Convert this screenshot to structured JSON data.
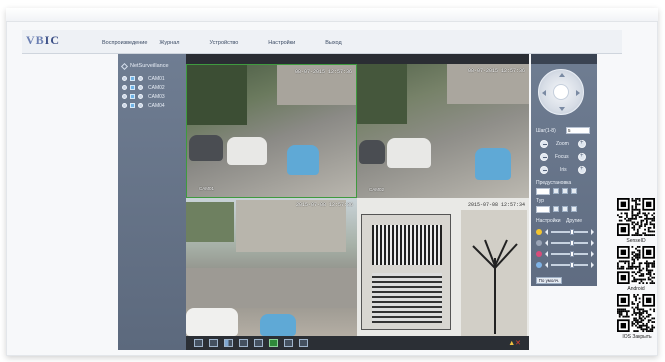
{
  "app": {
    "logo_part1": "VB",
    "logo_part2": "IC"
  },
  "nav": {
    "items": [
      "Воспроизведение",
      "Журнал",
      "Устройство",
      "Настройки",
      "Выход"
    ]
  },
  "left_panel": {
    "title": "NetSurveillance",
    "cameras": [
      "CAM01",
      "CAM02",
      "CAM03",
      "CAM04"
    ]
  },
  "video": {
    "tiles": [
      {
        "timestamp": "08-07-2015 12:57:36",
        "label": "CAM01"
      },
      {
        "timestamp": "08-07-2015 12:57:36",
        "label": "CAM02"
      },
      {
        "timestamp": "2015-07-08 12:57:36",
        "label": ""
      },
      {
        "timestamp": "2015-07-08 12:57:34",
        "label": ""
      }
    ]
  },
  "ptz": {
    "speed_label": "Шаг(1-8)",
    "speed_value": "5",
    "zoom_label": "Zoom",
    "focus_label": "Focus",
    "iris_label": "Iris",
    "preset_label": "Предустановка",
    "tour_label": "Тур",
    "settings_label": "Настройки",
    "other_label": "Другие",
    "default_button": "По умолч."
  },
  "image_sliders": [
    {
      "name": "brightness",
      "icon_color": "#f3c52e",
      "level": 0.5
    },
    {
      "name": "contrast",
      "icon_color": "#9aa4b6",
      "level": 0.5
    },
    {
      "name": "saturation",
      "icon_color": "#d94b7a",
      "level": 0.5
    },
    {
      "name": "hue",
      "icon_color": "#7fb3e6",
      "level": 0.5
    }
  ],
  "qr_codes": [
    {
      "label": "SenseID"
    },
    {
      "label": "Android"
    },
    {
      "label": "IOS Закрыть"
    }
  ],
  "colors": {
    "panel": "#66748a",
    "video_bg": "#1c1d1f",
    "active_border": "#3f9a3f"
  }
}
